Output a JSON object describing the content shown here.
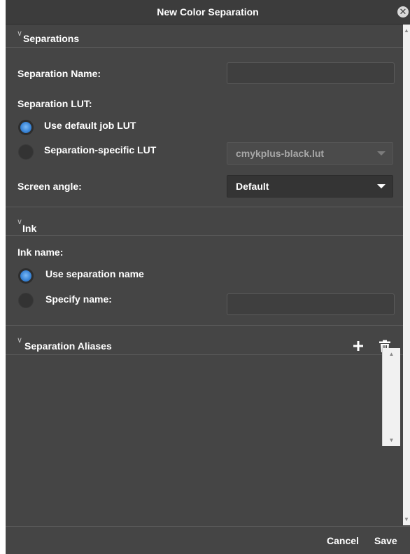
{
  "dialog": {
    "title": "New Color Separation",
    "close_icon": "close-circle-icon"
  },
  "separations": {
    "title": "Separations",
    "name_label": "Separation Name:",
    "name_value": "",
    "lut_label": "Separation LUT:",
    "lut_options": [
      {
        "label": "Use default job LUT",
        "selected": true
      },
      {
        "label": "Separation-specific LUT",
        "selected": false
      }
    ],
    "lut_select_value": "cmykplus-black.lut",
    "screen_angle_label": "Screen angle:",
    "screen_angle_value": "Default"
  },
  "ink": {
    "title": "Ink",
    "name_label": "Ink name:",
    "options": [
      {
        "label": "Use separation name",
        "selected": true
      },
      {
        "label": "Specify name:",
        "selected": false
      }
    ],
    "specify_value": ""
  },
  "aliases": {
    "title": "Separation Aliases",
    "add_icon": "plus-icon",
    "delete_icon": "trash-icon",
    "items": []
  },
  "footer": {
    "cancel_label": "Cancel",
    "save_label": "Save"
  },
  "colors": {
    "panel_bg": "#454545",
    "title_bg": "#3c3c3c",
    "accent_radio": "#3c87d8",
    "text": "#ffffff"
  }
}
